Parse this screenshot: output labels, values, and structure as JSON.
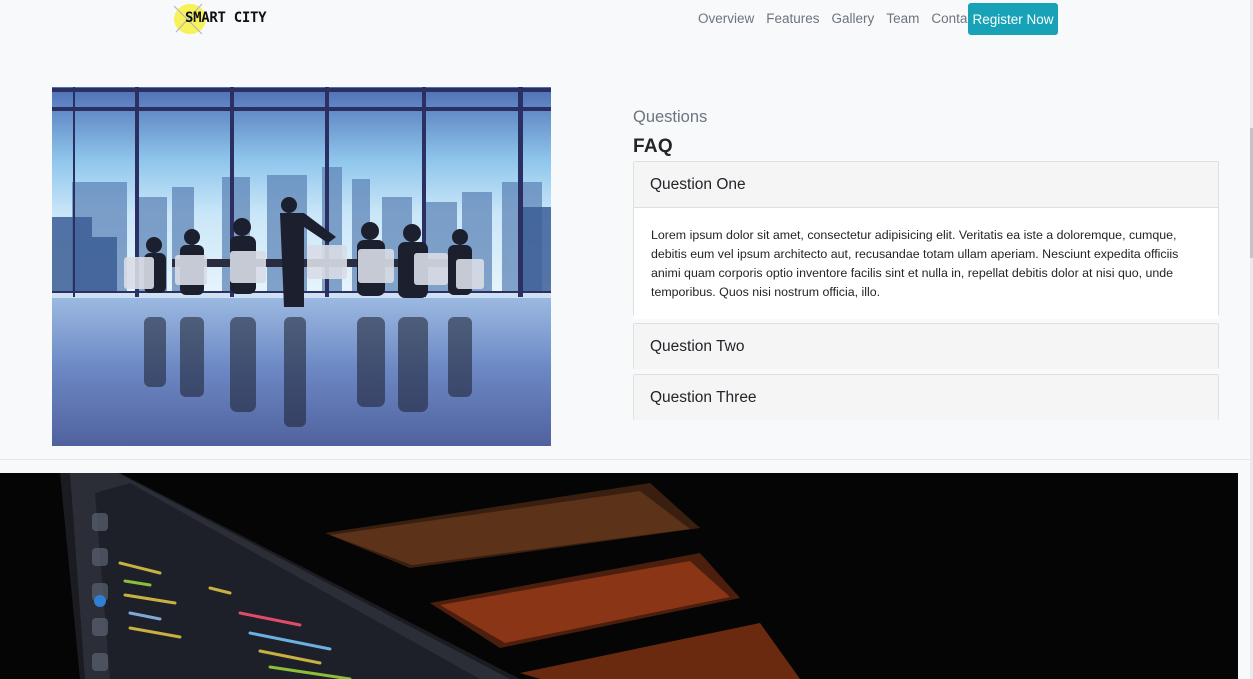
{
  "navbar": {
    "logo_text": "SMART CITY",
    "links": [
      "Overview",
      "Features",
      "Gallery",
      "Team",
      "Contact"
    ],
    "register_label": "Register Now",
    "accent_color": "#17a2b8"
  },
  "faq": {
    "subtitle": "Questions",
    "title": "FAQ",
    "items": [
      {
        "question": "Question One",
        "answer": "Lorem ipsum dolor sit amet, consectetur adipisicing elit. Veritatis ea iste a doloremque, cumque, debitis eum vel ipsum architecto aut, recusandae totam ullam aperiam. Nesciunt expedita officiis animi quam corporis optio inventore facilis sint et nulla in, repellat debitis dolor at nisi quo, unde temporibus. Quos nisi nostrum officia, illo.",
        "expanded": true
      },
      {
        "question": "Question Two",
        "expanded": false
      },
      {
        "question": "Question Three",
        "expanded": false
      }
    ]
  }
}
